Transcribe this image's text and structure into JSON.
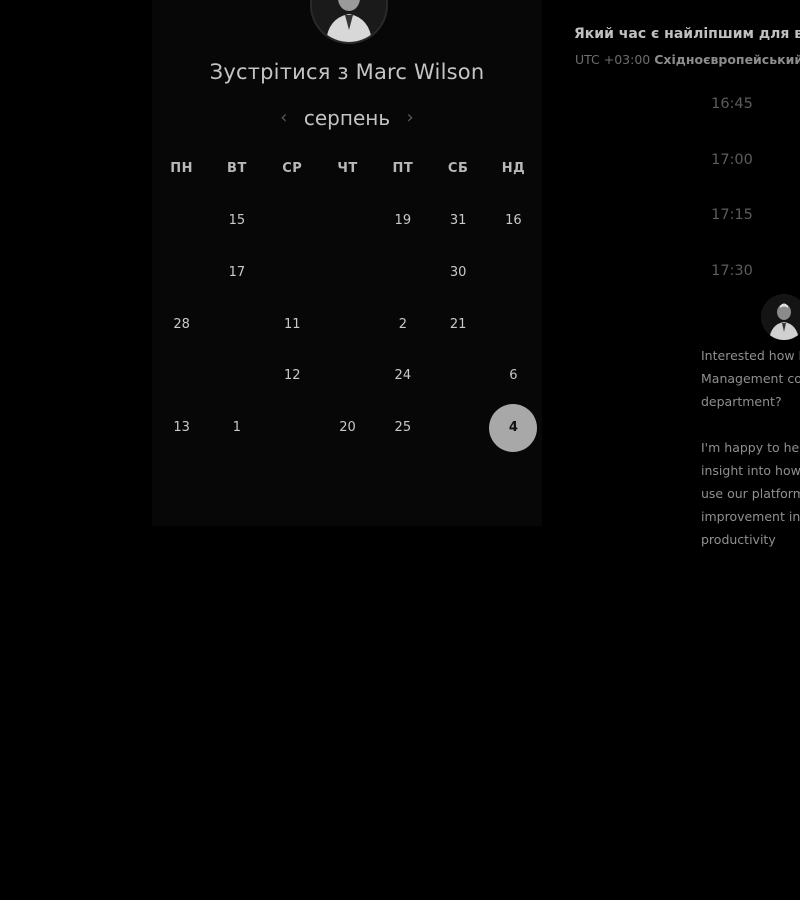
{
  "booking": {
    "title_prefix": "Зустрітися з ",
    "host_name": "Marc Wilson",
    "month": "серпень",
    "prev_icon": "‹",
    "next_icon": "›",
    "weekdays": [
      "ПН",
      "ВТ",
      "СР",
      "ЧТ",
      "ПТ",
      "СБ",
      "НД"
    ],
    "days": [
      {
        "label": "",
        "state": "inactive"
      },
      {
        "label": "15",
        "state": "active"
      },
      {
        "label": "",
        "state": "inactive"
      },
      {
        "label": "",
        "state": "inactive"
      },
      {
        "label": "19",
        "state": "active"
      },
      {
        "label": "31",
        "state": "active"
      },
      {
        "label": "16",
        "state": "active"
      },
      {
        "label": "",
        "state": "inactive"
      },
      {
        "label": "17",
        "state": "active"
      },
      {
        "label": "",
        "state": "inactive"
      },
      {
        "label": "",
        "state": "inactive"
      },
      {
        "label": "",
        "state": "inactive"
      },
      {
        "label": "30",
        "state": "active"
      },
      {
        "label": "",
        "state": "inactive"
      },
      {
        "label": "28",
        "state": "active"
      },
      {
        "label": "",
        "state": "inactive"
      },
      {
        "label": "11",
        "state": "active"
      },
      {
        "label": "",
        "state": "inactive"
      },
      {
        "label": "2",
        "state": "active"
      },
      {
        "label": "21",
        "state": "active"
      },
      {
        "label": "",
        "state": "inactive"
      },
      {
        "label": "",
        "state": "inactive"
      },
      {
        "label": "",
        "state": "inactive"
      },
      {
        "label": "12",
        "state": "active"
      },
      {
        "label": "",
        "state": "inactive"
      },
      {
        "label": "24",
        "state": "active"
      },
      {
        "label": "",
        "state": "inactive"
      },
      {
        "label": "6",
        "state": "active"
      },
      {
        "label": "13",
        "state": "active"
      },
      {
        "label": "1",
        "state": "active"
      },
      {
        "label": "",
        "state": "inactive"
      },
      {
        "label": "20",
        "state": "active"
      },
      {
        "label": "25",
        "state": "active"
      },
      {
        "label": "",
        "state": "inactive"
      },
      {
        "label": "4",
        "state": "selected"
      }
    ]
  },
  "time_panel": {
    "question": "Який час є найліпшим для ва",
    "tz_prefix": "UTC +03:00 ",
    "tz_name": "Східноєвропейський",
    "slots": [
      "16:45",
      "17:00",
      "17:15",
      "17:30"
    ]
  },
  "message": {
    "lines": [
      "Interested how B",
      "Management co",
      "department?",
      "",
      "I'm happy to help",
      "insight into how",
      "use our platform",
      "improvement in",
      "productivity"
    ]
  },
  "colors": {
    "background": "#000000",
    "panel": "#070707",
    "selected_day": "#a8a8a8",
    "active_text": "#c9c9c9",
    "muted_text": "#5c5c5c"
  },
  "icons": {
    "prev": "chevron-left-icon",
    "next": "chevron-right-icon",
    "host_avatar": "avatar"
  }
}
